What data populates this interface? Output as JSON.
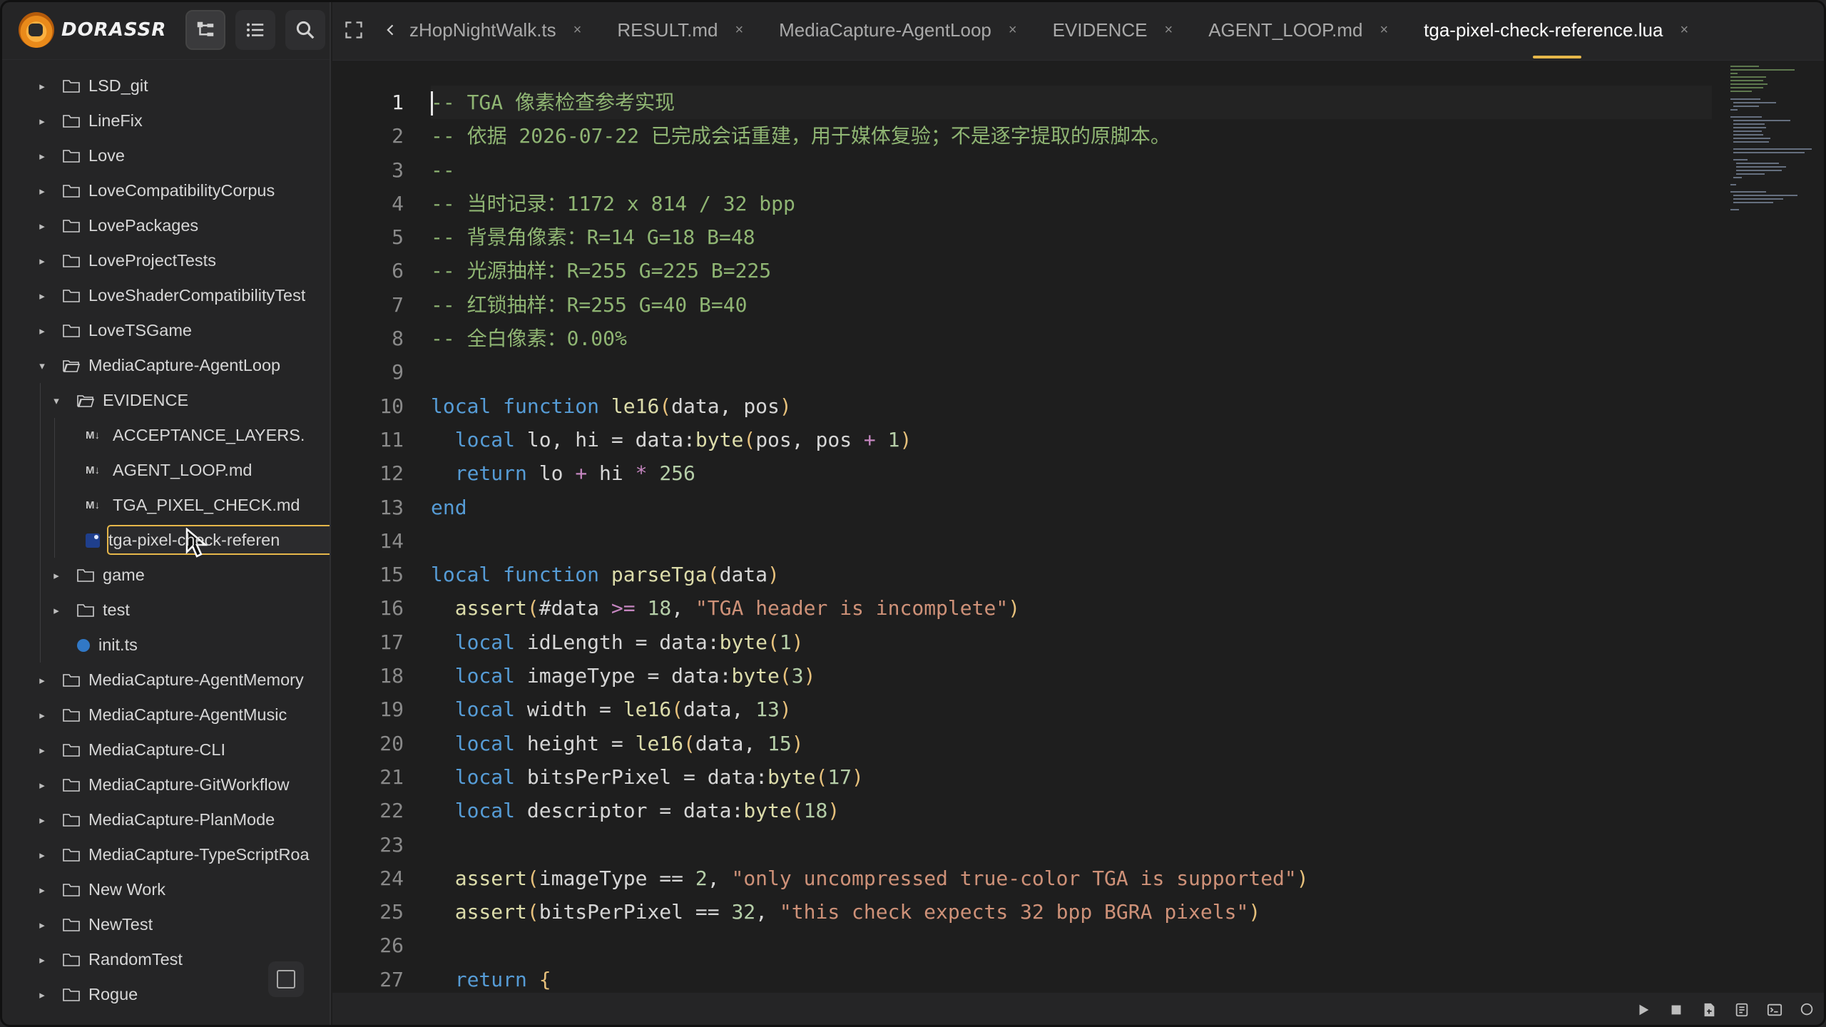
{
  "app": {
    "logo_text": "DORASSR"
  },
  "sidebar": {
    "items": [
      {
        "label": "LSD_git",
        "type": "folder",
        "expanded": false,
        "depth": 0
      },
      {
        "label": "LineFix",
        "type": "folder",
        "expanded": false,
        "depth": 0
      },
      {
        "label": "Love",
        "type": "folder",
        "expanded": false,
        "depth": 0
      },
      {
        "label": "LoveCompatibilityCorpus",
        "type": "folder",
        "expanded": false,
        "depth": 0
      },
      {
        "label": "LovePackages",
        "type": "folder",
        "expanded": false,
        "depth": 0
      },
      {
        "label": "LoveProjectTests",
        "type": "folder",
        "expanded": false,
        "depth": 0
      },
      {
        "label": "LoveShaderCompatibilityTest",
        "type": "folder",
        "expanded": false,
        "depth": 0
      },
      {
        "label": "LoveTSGame",
        "type": "folder",
        "expanded": false,
        "depth": 0
      },
      {
        "label": "MediaCapture-AgentLoop",
        "type": "folder",
        "expanded": true,
        "depth": 0
      },
      {
        "label": "EVIDENCE",
        "type": "folder",
        "expanded": true,
        "depth": 1
      },
      {
        "label": "ACCEPTANCE_LAYERS.",
        "type": "md",
        "depth": 2
      },
      {
        "label": "AGENT_LOOP.md",
        "type": "md",
        "depth": 2
      },
      {
        "label": "TGA_PIXEL_CHECK.md",
        "type": "md",
        "depth": 2
      },
      {
        "label": "tga-pixel-check-referen",
        "type": "lua",
        "depth": 2,
        "selected": true
      },
      {
        "label": "game",
        "type": "folder",
        "expanded": false,
        "depth": 1
      },
      {
        "label": "test",
        "type": "folder",
        "expanded": false,
        "depth": 1
      },
      {
        "label": "init.ts",
        "type": "ts",
        "depth": 1
      },
      {
        "label": "MediaCapture-AgentMemory",
        "type": "folder",
        "expanded": false,
        "depth": 0
      },
      {
        "label": "MediaCapture-AgentMusic",
        "type": "folder",
        "expanded": false,
        "depth": 0
      },
      {
        "label": "MediaCapture-CLI",
        "type": "folder",
        "expanded": false,
        "depth": 0
      },
      {
        "label": "MediaCapture-GitWorkflow",
        "type": "folder",
        "expanded": false,
        "depth": 0
      },
      {
        "label": "MediaCapture-PlanMode",
        "type": "folder",
        "expanded": false,
        "depth": 0
      },
      {
        "label": "MediaCapture-TypeScriptRoa",
        "type": "folder",
        "expanded": false,
        "depth": 0
      },
      {
        "label": "New Work",
        "type": "folder",
        "expanded": false,
        "depth": 0
      },
      {
        "label": "NewTest",
        "type": "folder",
        "expanded": false,
        "depth": 0
      },
      {
        "label": "RandomTest",
        "type": "folder",
        "expanded": false,
        "depth": 0
      },
      {
        "label": "Rogue",
        "type": "folder",
        "expanded": false,
        "depth": 0
      }
    ]
  },
  "tabs": [
    {
      "label": "zHopNightWalk.ts",
      "close": "×"
    },
    {
      "label": "RESULT.md",
      "close": "×"
    },
    {
      "label": "MediaCapture-AgentLoop",
      "close": "×"
    },
    {
      "label": "EVIDENCE",
      "close": "×"
    },
    {
      "label": "AGENT_LOOP.md",
      "close": "×"
    },
    {
      "label": "tga-pixel-check-reference.lua",
      "close": "×",
      "active": true
    }
  ],
  "editor": {
    "current_line": 1,
    "lines": [
      [
        [
          "cm",
          "-- TGA 像素检查参考实现"
        ]
      ],
      [
        [
          "cm",
          "-- 依据 2026-07-22 已完成会话重建，用于媒体复验；不是逐字提取的原脚本。"
        ]
      ],
      [
        [
          "cm",
          "--"
        ]
      ],
      [
        [
          "cm",
          "-- 当时记录：1172 x 814 / 32 bpp"
        ]
      ],
      [
        [
          "cm",
          "-- 背景角像素：R=14 G=18 B=48"
        ]
      ],
      [
        [
          "cm",
          "-- 光源抽样：R=255 G=225 B=225"
        ]
      ],
      [
        [
          "cm",
          "-- 红锁抽样：R=255 G=40 B=40"
        ]
      ],
      [
        [
          "cm",
          "-- 全白像素：0.00%"
        ]
      ],
      [],
      [
        [
          "kw",
          "local"
        ],
        [
          "vr",
          " "
        ],
        [
          "kw",
          "function"
        ],
        [
          "vr",
          " "
        ],
        [
          "fn",
          "le16"
        ],
        [
          "pr",
          "("
        ],
        [
          "vr",
          "data, pos"
        ],
        [
          "pr",
          ")"
        ]
      ],
      [
        [
          "vr",
          "  "
        ],
        [
          "kw",
          "local"
        ],
        [
          "vr",
          " lo, hi = data:"
        ],
        [
          "fn",
          "byte"
        ],
        [
          "pr",
          "("
        ],
        [
          "vr",
          "pos, pos "
        ],
        [
          "op",
          "+"
        ],
        [
          "vr",
          " "
        ],
        [
          "nm",
          "1"
        ],
        [
          "pr",
          ")"
        ]
      ],
      [
        [
          "vr",
          "  "
        ],
        [
          "kw",
          "return"
        ],
        [
          "vr",
          " lo "
        ],
        [
          "op",
          "+"
        ],
        [
          "vr",
          " hi "
        ],
        [
          "op",
          "*"
        ],
        [
          "vr",
          " "
        ],
        [
          "nm",
          "256"
        ]
      ],
      [
        [
          "kw",
          "end"
        ]
      ],
      [],
      [
        [
          "kw",
          "local"
        ],
        [
          "vr",
          " "
        ],
        [
          "kw",
          "function"
        ],
        [
          "vr",
          " "
        ],
        [
          "fn",
          "parseTga"
        ],
        [
          "pr",
          "("
        ],
        [
          "vr",
          "data"
        ],
        [
          "pr",
          ")"
        ]
      ],
      [
        [
          "vr",
          "  "
        ],
        [
          "fn",
          "assert"
        ],
        [
          "pr",
          "("
        ],
        [
          "vr",
          "#data "
        ],
        [
          "op",
          ">="
        ],
        [
          "vr",
          " "
        ],
        [
          "nm",
          "18"
        ],
        [
          "vr",
          ", "
        ],
        [
          "st",
          "\"TGA header is incomplete\""
        ],
        [
          "pr",
          ")"
        ]
      ],
      [
        [
          "vr",
          "  "
        ],
        [
          "kw",
          "local"
        ],
        [
          "vr",
          " idLength = data:"
        ],
        [
          "fn",
          "byte"
        ],
        [
          "pr",
          "("
        ],
        [
          "nm",
          "1"
        ],
        [
          "pr",
          ")"
        ]
      ],
      [
        [
          "vr",
          "  "
        ],
        [
          "kw",
          "local"
        ],
        [
          "vr",
          " imageType = data:"
        ],
        [
          "fn",
          "byte"
        ],
        [
          "pr",
          "("
        ],
        [
          "nm",
          "3"
        ],
        [
          "pr",
          ")"
        ]
      ],
      [
        [
          "vr",
          "  "
        ],
        [
          "kw",
          "local"
        ],
        [
          "vr",
          " width = "
        ],
        [
          "fn",
          "le16"
        ],
        [
          "pr",
          "("
        ],
        [
          "vr",
          "data, "
        ],
        [
          "nm",
          "13"
        ],
        [
          "pr",
          ")"
        ]
      ],
      [
        [
          "vr",
          "  "
        ],
        [
          "kw",
          "local"
        ],
        [
          "vr",
          " height = "
        ],
        [
          "fn",
          "le16"
        ],
        [
          "pr",
          "("
        ],
        [
          "vr",
          "data, "
        ],
        [
          "nm",
          "15"
        ],
        [
          "pr",
          ")"
        ]
      ],
      [
        [
          "vr",
          "  "
        ],
        [
          "kw",
          "local"
        ],
        [
          "vr",
          " bitsPerPixel = data:"
        ],
        [
          "fn",
          "byte"
        ],
        [
          "pr",
          "("
        ],
        [
          "nm",
          "17"
        ],
        [
          "pr",
          ")"
        ]
      ],
      [
        [
          "vr",
          "  "
        ],
        [
          "kw",
          "local"
        ],
        [
          "vr",
          " descriptor = data:"
        ],
        [
          "fn",
          "byte"
        ],
        [
          "pr",
          "("
        ],
        [
          "nm",
          "18"
        ],
        [
          "pr",
          ")"
        ]
      ],
      [],
      [
        [
          "vr",
          "  "
        ],
        [
          "fn",
          "assert"
        ],
        [
          "pr",
          "("
        ],
        [
          "vr",
          "imageType == "
        ],
        [
          "nm",
          "2"
        ],
        [
          "vr",
          ", "
        ],
        [
          "st",
          "\"only uncompressed true-color TGA is supported\""
        ],
        [
          "pr",
          ")"
        ]
      ],
      [
        [
          "vr",
          "  "
        ],
        [
          "fn",
          "assert"
        ],
        [
          "pr",
          "("
        ],
        [
          "vr",
          "bitsPerPixel == "
        ],
        [
          "nm",
          "32"
        ],
        [
          "vr",
          ", "
        ],
        [
          "st",
          "\"this check expects 32 bpp BGRA pixels\""
        ],
        [
          "pr",
          ")"
        ]
      ],
      [],
      [
        [
          "vr",
          "  "
        ],
        [
          "kw",
          "return"
        ],
        [
          "vr",
          " "
        ],
        [
          "pr",
          "{"
        ]
      ]
    ]
  },
  "statusbar": {
    "icons": [
      "play-icon",
      "stop-icon",
      "file-icon",
      "notes-icon",
      "terminal-icon",
      "search-icon"
    ]
  },
  "colors": {
    "accent": "#e6b74a",
    "background": "#1e1e1e",
    "sidebar": "#252526"
  }
}
